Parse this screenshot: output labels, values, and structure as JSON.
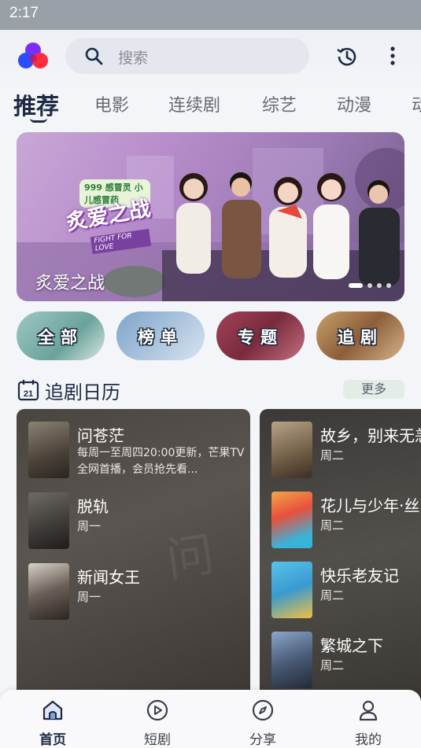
{
  "status_bar": {
    "time": "2:17"
  },
  "header": {
    "search_placeholder": "搜索",
    "icons": [
      "app-logo-icon",
      "search-icon",
      "history-icon",
      "more-vertical-icon"
    ]
  },
  "tabs": [
    {
      "label": "推荐",
      "active": true
    },
    {
      "label": "电影"
    },
    {
      "label": "连续剧"
    },
    {
      "label": "综艺"
    },
    {
      "label": "动漫"
    },
    {
      "label": "动"
    }
  ],
  "banner": {
    "title": "炙爱之战",
    "badge": "999 感冒灵 小儿感冒药",
    "show_logo": "炙爱之战",
    "show_logo_sub": "FIGHT FOR LOVE",
    "page_count": 4,
    "active_page": 1
  },
  "categories": [
    {
      "label": "全部"
    },
    {
      "label": "榜单"
    },
    {
      "label": "专题"
    },
    {
      "label": "追剧"
    }
  ],
  "section": {
    "title": "追剧日历",
    "more_label": "更多",
    "calendar_icon_text": "21"
  },
  "calendar": {
    "left": [
      {
        "name": "问苍茫",
        "description": "每周一至周四20:00更新，芒果TV全网首播，会员抢先看..."
      },
      {
        "name": "脱轨",
        "day": "周一"
      },
      {
        "name": "新闻女王",
        "day": "周一"
      }
    ],
    "right": [
      {
        "name": "故乡，别来无恙",
        "day": "周二"
      },
      {
        "name": "花儿与少年·丝",
        "day": "周二"
      },
      {
        "name": "快乐老友记",
        "day": "周二"
      },
      {
        "name": "繁城之下",
        "day": "周二"
      }
    ]
  },
  "bottom_nav": [
    {
      "label": "首页",
      "icon": "home-icon",
      "active": true
    },
    {
      "label": "短剧",
      "icon": "play-circle-icon"
    },
    {
      "label": "分享",
      "icon": "compass-icon"
    },
    {
      "label": "我的",
      "icon": "user-icon"
    }
  ],
  "colors": {
    "accent": "#1d2a44",
    "background": "#f4f5f8",
    "search_bg": "#e4e7ee"
  }
}
